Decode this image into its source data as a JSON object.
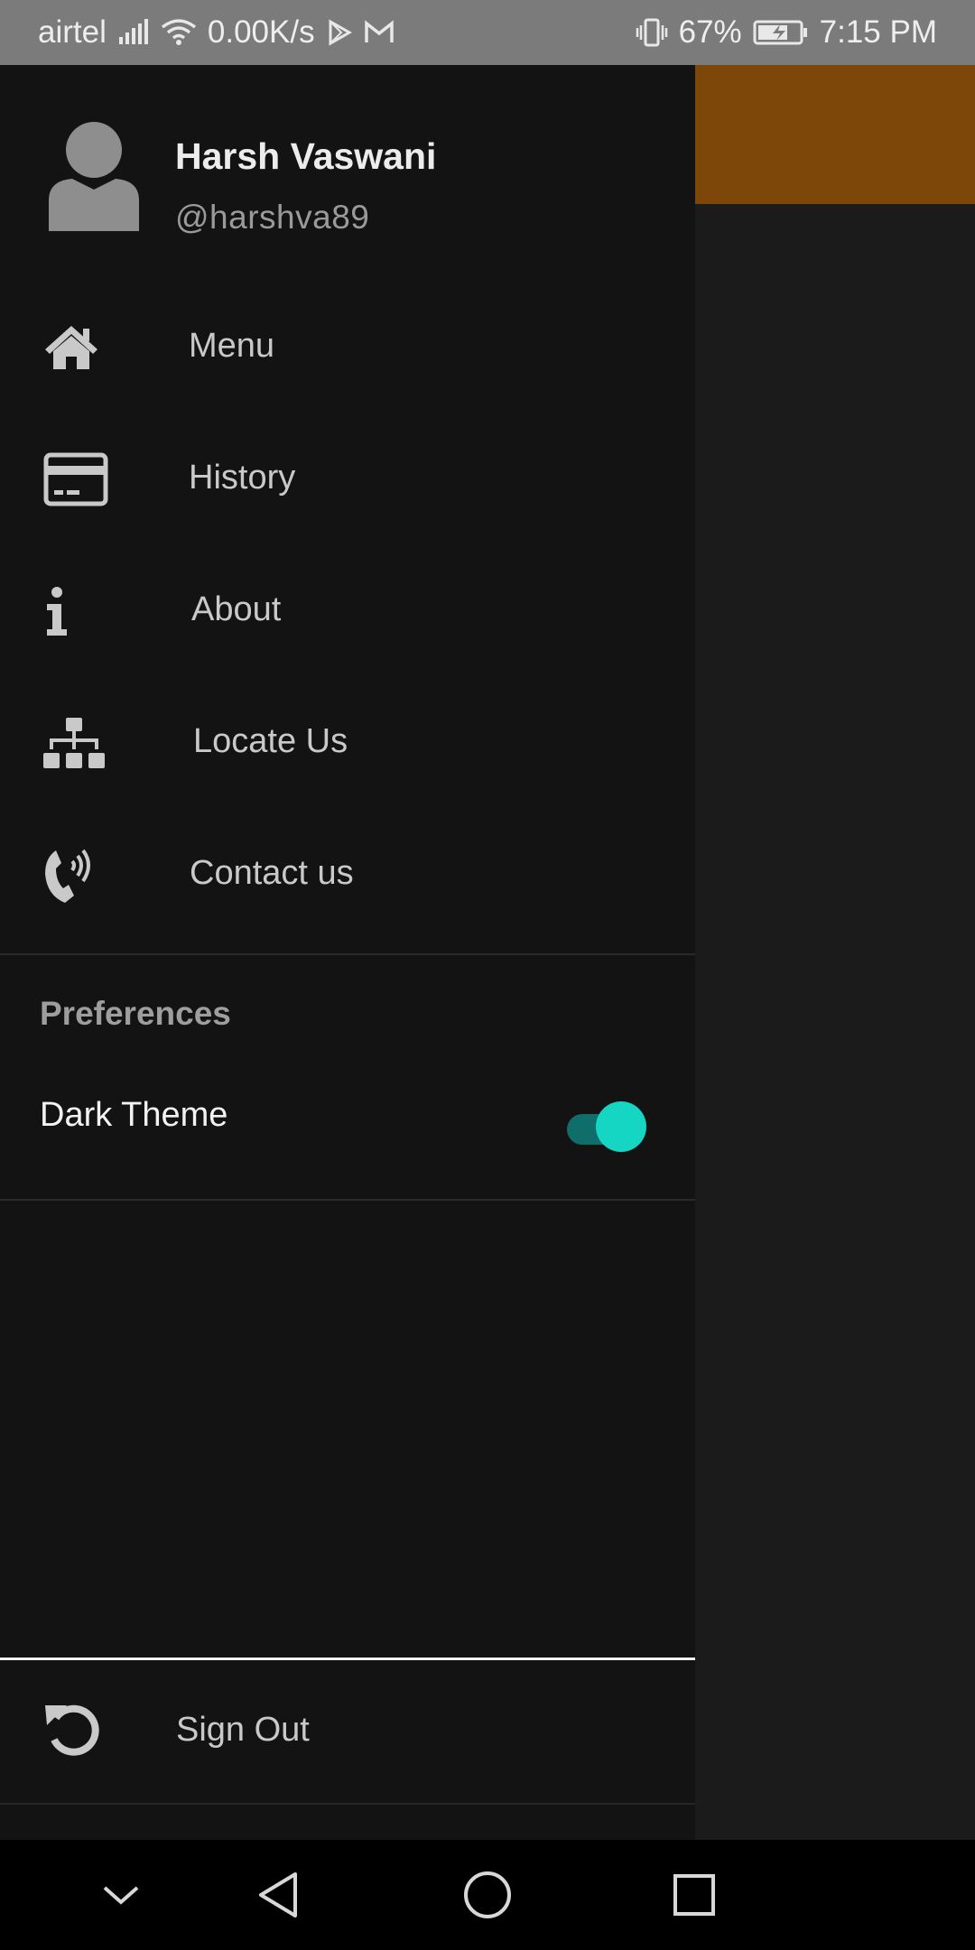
{
  "status_bar": {
    "carrier": "airtel",
    "network_speed": "0.00K/s",
    "battery_percent": "67%",
    "time": "7:15 PM",
    "icons": [
      "signal-icon",
      "wifi-icon",
      "play-store-icon",
      "gmail-icon",
      "vibrate-icon",
      "battery-charging-icon"
    ]
  },
  "drawer": {
    "user": {
      "name": "Harsh Vaswani",
      "handle": "@harshva89",
      "avatar_icon": "person-icon"
    },
    "items": [
      {
        "label": "Menu",
        "icon": "home-icon"
      },
      {
        "label": "History",
        "icon": "credit-card-icon"
      },
      {
        "label": "About",
        "icon": "info-icon"
      },
      {
        "label": "Locate Us",
        "icon": "sitemap-icon"
      },
      {
        "label": "Contact us",
        "icon": "phone-volume-icon"
      }
    ],
    "preferences": {
      "title": "Preferences",
      "dark_theme_label": "Dark Theme",
      "dark_theme_enabled": true
    },
    "sign_out": {
      "label": "Sign Out",
      "icon": "undo-icon"
    }
  },
  "colors": {
    "drawer_bg": "#131313",
    "app_bar": "#7d4709",
    "switch_thumb": "#14d6c2",
    "switch_track": "#0f6e69"
  },
  "nav_bar": {
    "buttons": [
      "collapse-icon",
      "back-icon",
      "home-circle-icon",
      "recents-icon"
    ]
  }
}
